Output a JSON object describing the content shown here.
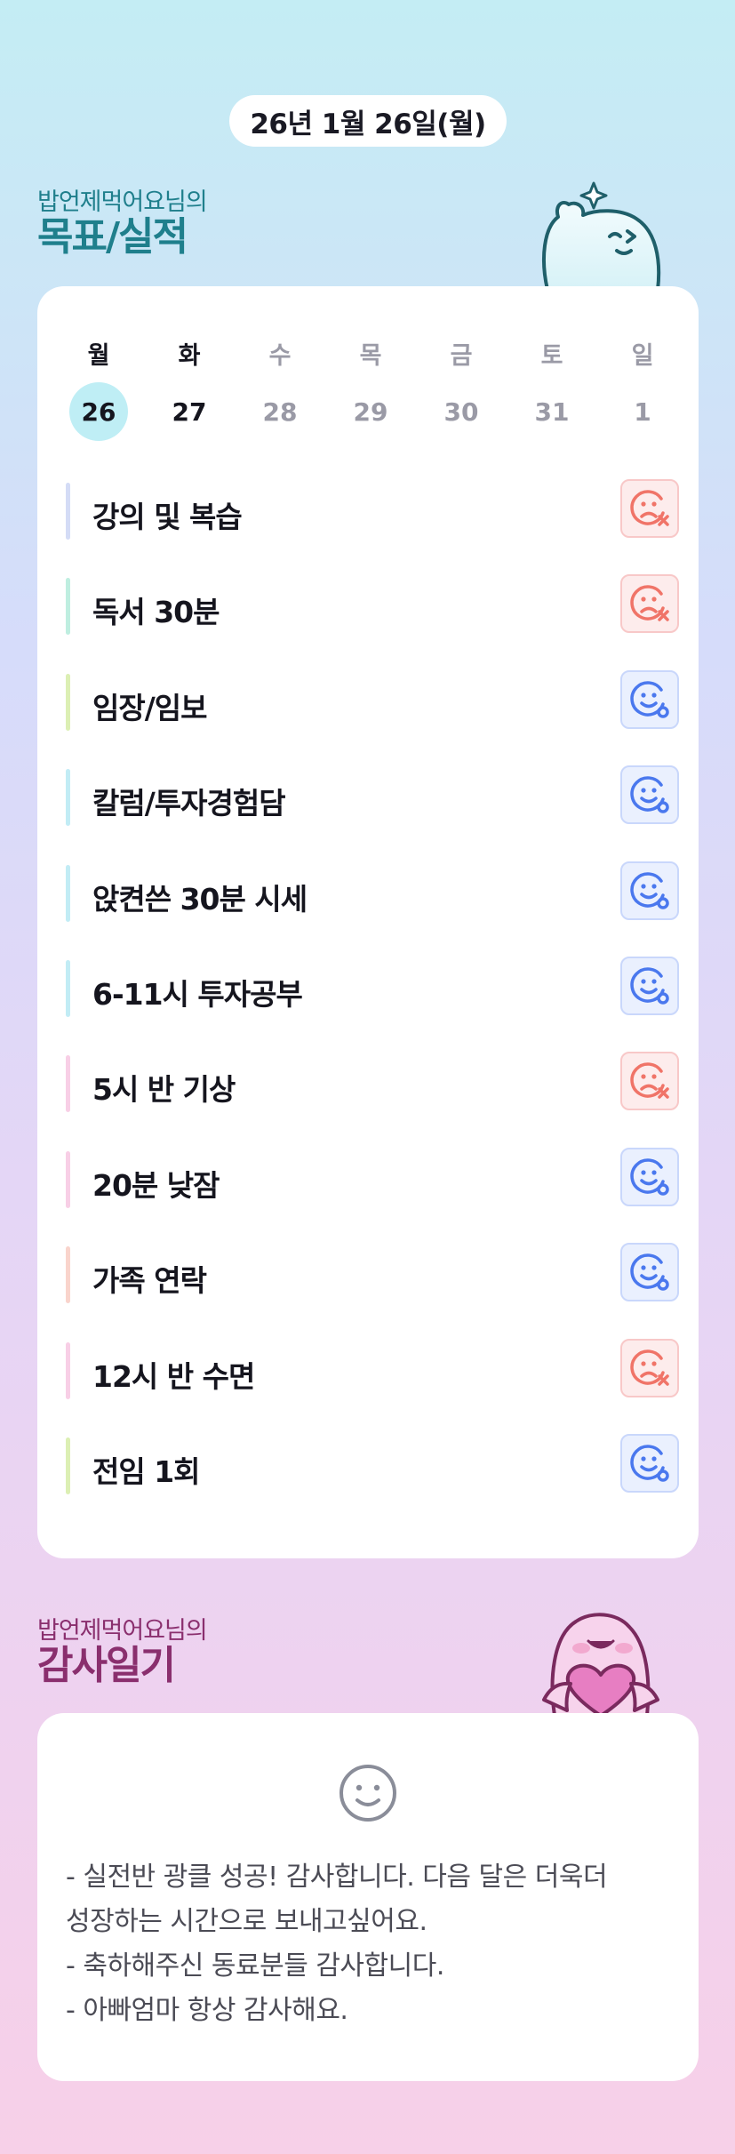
{
  "date_label": "26년 1월 26일(월)",
  "goals_section": {
    "subtitle": "밥언제먹어요님의",
    "title": "목표/실적"
  },
  "week": [
    {
      "day": "월",
      "num": "26",
      "selected": true,
      "style": "dark"
    },
    {
      "day": "화",
      "num": "27",
      "selected": false,
      "style": "dark"
    },
    {
      "day": "수",
      "num": "28",
      "selected": false,
      "style": "muted"
    },
    {
      "day": "목",
      "num": "29",
      "selected": false,
      "style": "muted"
    },
    {
      "day": "금",
      "num": "30",
      "selected": false,
      "style": "muted"
    },
    {
      "day": "토",
      "num": "31",
      "selected": false,
      "style": "muted"
    },
    {
      "day": "일",
      "num": "1",
      "selected": false,
      "style": "muted"
    }
  ],
  "goals": [
    {
      "label": "강의 및 복습",
      "status": "fail",
      "bar_color": "#d4dcf6"
    },
    {
      "label": "독서 30분",
      "status": "fail",
      "bar_color": "#bfeee0"
    },
    {
      "label": "임장/임보",
      "status": "done",
      "bar_color": "#dcefb4"
    },
    {
      "label": "칼럼/투자경험담",
      "status": "done",
      "bar_color": "#c2ecf5"
    },
    {
      "label": "앉켠쓴 30분 시세",
      "status": "done",
      "bar_color": "#c2ecf5"
    },
    {
      "label": "6-11시 투자공부",
      "status": "done",
      "bar_color": "#c2ecf5"
    },
    {
      "label": "5시 반 기상",
      "status": "fail",
      "bar_color": "#f8cfe6"
    },
    {
      "label": "20분 낮잠",
      "status": "done",
      "bar_color": "#f8cfe6"
    },
    {
      "label": "가족 연락",
      "status": "done",
      "bar_color": "#f9d4cc"
    },
    {
      "label": "12시 반 수면",
      "status": "fail",
      "bar_color": "#f8cfe6"
    },
    {
      "label": "전임 1회",
      "status": "done",
      "bar_color": "#dcefb4"
    }
  ],
  "diary_section": {
    "subtitle": "밥언제먹어요님의",
    "title": "감사일기",
    "mood_icon": "smile-icon",
    "lines": [
      "- 실전반 광클 성공! 감사합니다. 다음 달은 더욱더",
      "성장하는 시간으로 보내고싶어요.",
      "- 축하해주신 동료분들 감사합니다.",
      "- 아빠엄마 항상 감사해요."
    ]
  },
  "colors": {
    "fail": "#f07468",
    "done": "#4a78ee",
    "teal_title": "#1f7f8c",
    "plum_title": "#8a2f6e"
  }
}
